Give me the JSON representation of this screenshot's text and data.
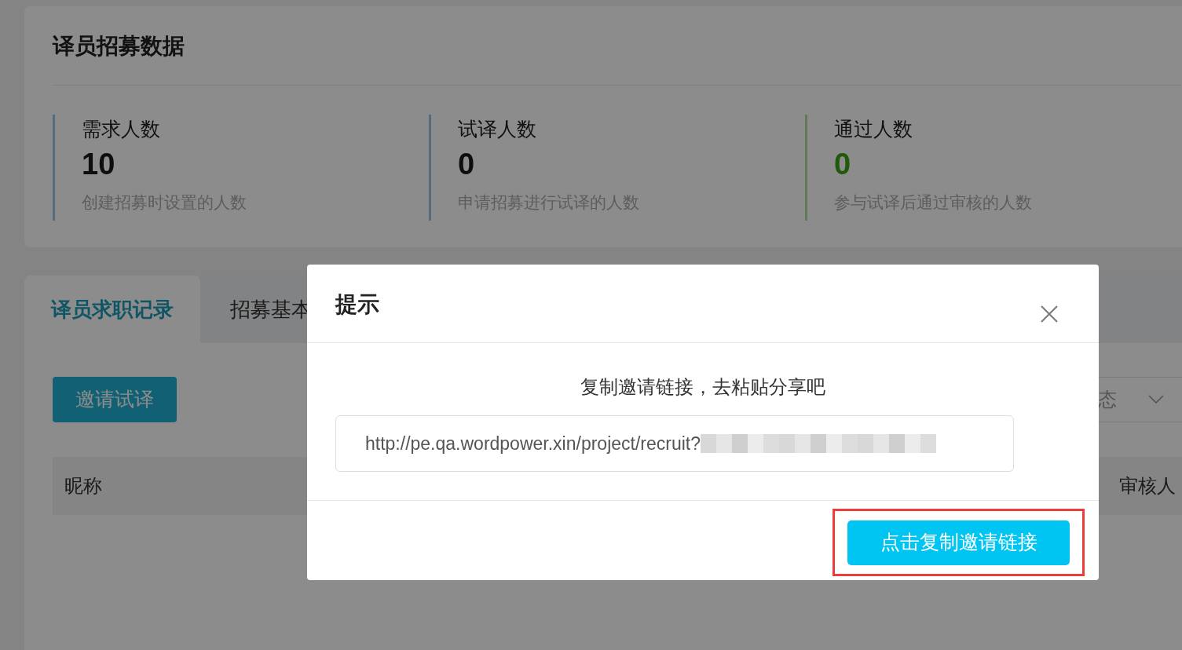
{
  "stats_card": {
    "title": "译员招募数据",
    "stats": [
      {
        "label": "需求人数",
        "value": "10",
        "hint": "创建招募时设置的人数",
        "kind": "neutral"
      },
      {
        "label": "试译人数",
        "value": "0",
        "hint": "申请招募进行试译的人数",
        "kind": "neutral"
      },
      {
        "label": "通过人数",
        "value": "0",
        "hint": "参与试译后通过审核的人数",
        "kind": "success"
      }
    ]
  },
  "tabs": [
    {
      "label": "译员求职记录",
      "selected": true
    },
    {
      "label": "招募基本",
      "selected": false
    }
  ],
  "invite_button": "邀请试译",
  "status_select": {
    "placeholder": "态"
  },
  "table": {
    "columns": [
      "昵称",
      "审核人"
    ]
  },
  "dialog": {
    "title": "提示",
    "message": "复制邀请链接，去粘贴分享吧",
    "link": "http://pe.qa.wordpower.xin/project/recruit?",
    "link_redacted": true,
    "button": "点击复制邀请链接",
    "button_highlighted": true
  }
}
